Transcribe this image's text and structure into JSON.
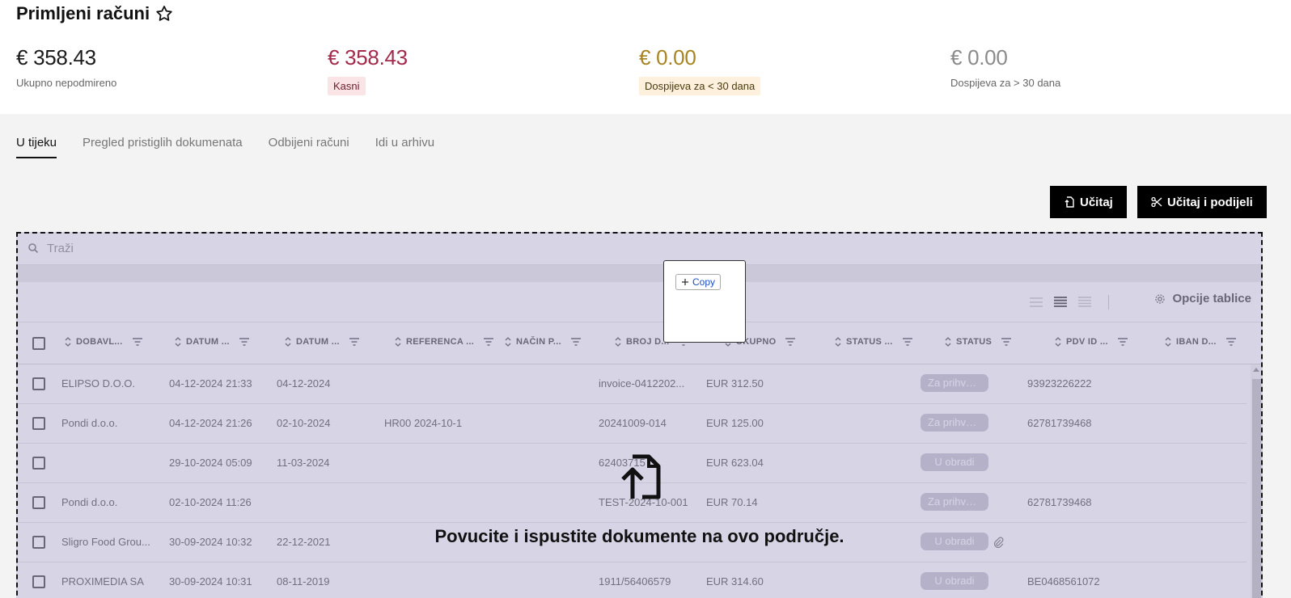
{
  "header": {
    "title": "Primljeni računi"
  },
  "kpis": [
    {
      "amount": "€ 358.43",
      "label": "Ukupno nepodmireno",
      "color": "#1b1b1b"
    },
    {
      "amount": "€ 358.43",
      "label": "Kasni",
      "color": "#a32a4a",
      "badge_bg": "#fbe4e6",
      "badge_fg": "#6b1d2b"
    },
    {
      "amount": "€ 0.00",
      "label": "Dospijeva za < 30 dana",
      "color": "#a7841f",
      "badge_bg": "#fdf0dc",
      "badge_fg": "#4a3a10"
    },
    {
      "amount": "€ 0.00",
      "label": "Dospijeva za > 30 dana",
      "color": "#8a8a8a"
    }
  ],
  "tabs": [
    {
      "label": "U tijeku",
      "active": true
    },
    {
      "label": "Pregled pristiglih dokumenata"
    },
    {
      "label": "Odbijeni računi"
    },
    {
      "label": "Idi u arhivu"
    }
  ],
  "actions": {
    "upload": "Učitaj",
    "upload_split": "Učitaj i podijeli"
  },
  "search": {
    "placeholder": "Traži"
  },
  "toolbar": {
    "table_options": "Opcije tablice"
  },
  "columns": [
    "DOBAVL...",
    "DATUM ...",
    "DATUM ...",
    "REFERENCA ...",
    "NAČIN P...",
    "BROJ D...",
    "UKUPNO",
    "STATUS ...",
    "STATUS",
    "PDV ID ...",
    "IBAN D..."
  ],
  "rows": [
    {
      "supplier": "ELIPSO D.O.O.",
      "created": "04-12-2024 21:33",
      "date": "04-12-2024",
      "reference": "",
      "number": "invoice-0412202...",
      "total": "EUR 312.50",
      "status": "Za prihvać...",
      "vat": "93923226222",
      "attachment": false
    },
    {
      "supplier": "Pondi d.o.o.",
      "created": "04-12-2024 21:26",
      "date": "02-10-2024",
      "reference": "HR00 2024-10-1",
      "number": "20241009-014",
      "total": "EUR 125.00",
      "status": "Za prihvać...",
      "vat": "62781739468",
      "attachment": false
    },
    {
      "supplier": "",
      "created": "29-10-2024 05:09",
      "date": "11-03-2024",
      "reference": "",
      "number": "62403715",
      "total": "EUR 623.04",
      "status": "U obradi",
      "vat": "",
      "attachment": false
    },
    {
      "supplier": "Pondi d.o.o.",
      "created": "02-10-2024 11:26",
      "date": "",
      "reference": "",
      "number": "TEST-2024-10-001",
      "total": "EUR 70.14",
      "status": "Za prihvać...",
      "vat": "62781739468",
      "attachment": false
    },
    {
      "supplier": "Sligro Food Grou...",
      "created": "30-09-2024 10:32",
      "date": "22-12-2021",
      "reference": "",
      "number": "",
      "total": "",
      "status": "U obradi",
      "vat": "",
      "attachment": true
    },
    {
      "supplier": "PROXIMEDIA SA",
      "created": "30-09-2024 10:31",
      "date": "08-11-2019",
      "reference": "",
      "number": "1911/56406579",
      "total": "EUR 314.60",
      "status": "U obradi",
      "vat": "BE0468561072",
      "attachment": false
    }
  ],
  "dropzone": {
    "message": "Povucite i ispustite dokumente na ovo područje."
  },
  "popup": {
    "copy_label": "Copy"
  }
}
